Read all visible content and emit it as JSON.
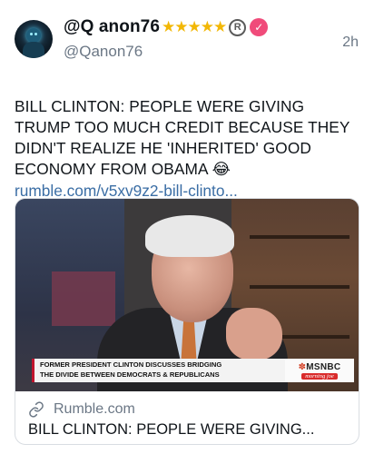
{
  "post": {
    "display_name": "@Q anon76",
    "badges": "★★★★★",
    "registered_symbol": "R",
    "verified_symbol": "✓",
    "handle": "@Qanon76",
    "time": "2h",
    "text": "BILL CLINTON: PEOPLE WERE GIVING TRUMP TOO MUCH CREDIT BECAUSE THEY DIDN'T REALIZE HE 'INHERITED' GOOD ECONOMY FROM OBAMA 😂",
    "link": "rumble.com/v5xv9z2-bill-clinto..."
  },
  "card": {
    "caption_line1": "FORMER PRESIDENT CLINTON DISCUSSES BRIDGING",
    "caption_line2": "THE DIVIDE BETWEEN DEMOCRATS & REPUBLICANS",
    "network": "MSNBC",
    "show": "morning joe",
    "domain": "Rumble.com",
    "title": "BILL CLINTON: PEOPLE WERE GIVING..."
  },
  "icons": {
    "avatar": "avatar-image",
    "link": "link-icon",
    "verified": "verified-badge-icon",
    "registered": "registered-icon"
  },
  "colors": {
    "link": "#3b6ea5",
    "star": "#f2b705",
    "verified": "#f04b7a",
    "secondary_text": "#6b7785"
  }
}
